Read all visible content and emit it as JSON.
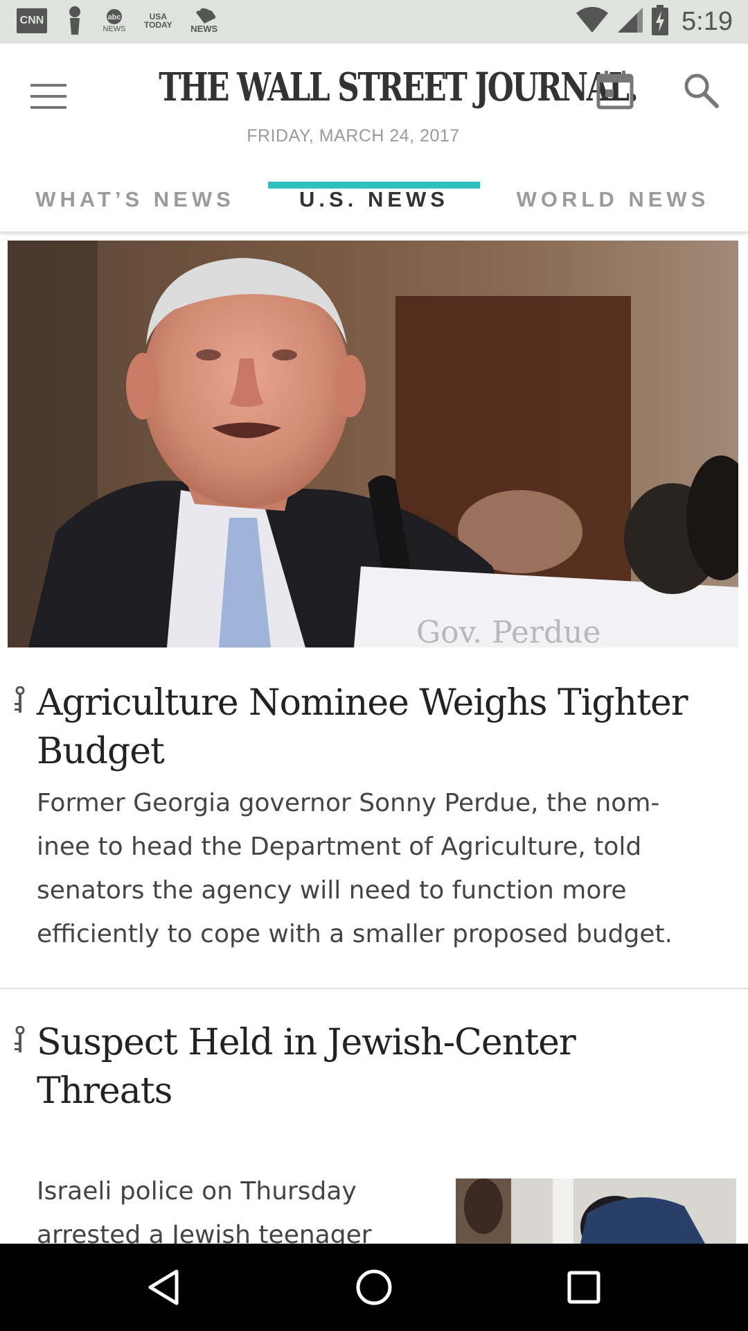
{
  "status_bar": {
    "time": "5:19",
    "notifications": [
      "CNN",
      "abc NEWS",
      "USA TODAY",
      "NBC NEWS"
    ],
    "icons": [
      "cnn-icon",
      "alert-icon",
      "abc-news-icon",
      "usa-today-icon",
      "nbc-news-icon",
      "wifi-icon",
      "signal-icon",
      "battery-charging-icon"
    ]
  },
  "header": {
    "masthead": "THE WALL STREET JOURNAL.",
    "date": "FRIDAY, MARCH 24, 2017",
    "menu_icon": "menu-icon",
    "calendar_icon": "calendar-icon",
    "search_icon": "search-icon"
  },
  "tabs": [
    {
      "label": "WHAT’S NEWS",
      "active": false
    },
    {
      "label": "U.S. NEWS",
      "active": true
    },
    {
      "label": "WORLD NEWS",
      "active": false
    }
  ],
  "accent_color": "#2ebfbf",
  "articles": [
    {
      "title_line1": "Agriculture Nominee Weighs Tighter",
      "title_line2": "Budget",
      "summary_lines": [
        "Former Georgia governor Sonny Perdue, the nom-",
        "inee to head the Department of Agriculture, told",
        "senators the agency will need to function more",
        "efficiently to cope with a smaller proposed budget."
      ],
      "image_caption_sign": "Gov. Perdue"
    },
    {
      "title_line1": "Suspect Held in Jewish-Center",
      "title_line2": "Threats",
      "summary_lines": [
        "Israeli police on Thursday",
        "arrested a Jewish teenager"
      ]
    }
  ],
  "navbar": {
    "icons": [
      "back-icon",
      "home-icon",
      "recents-icon"
    ]
  }
}
